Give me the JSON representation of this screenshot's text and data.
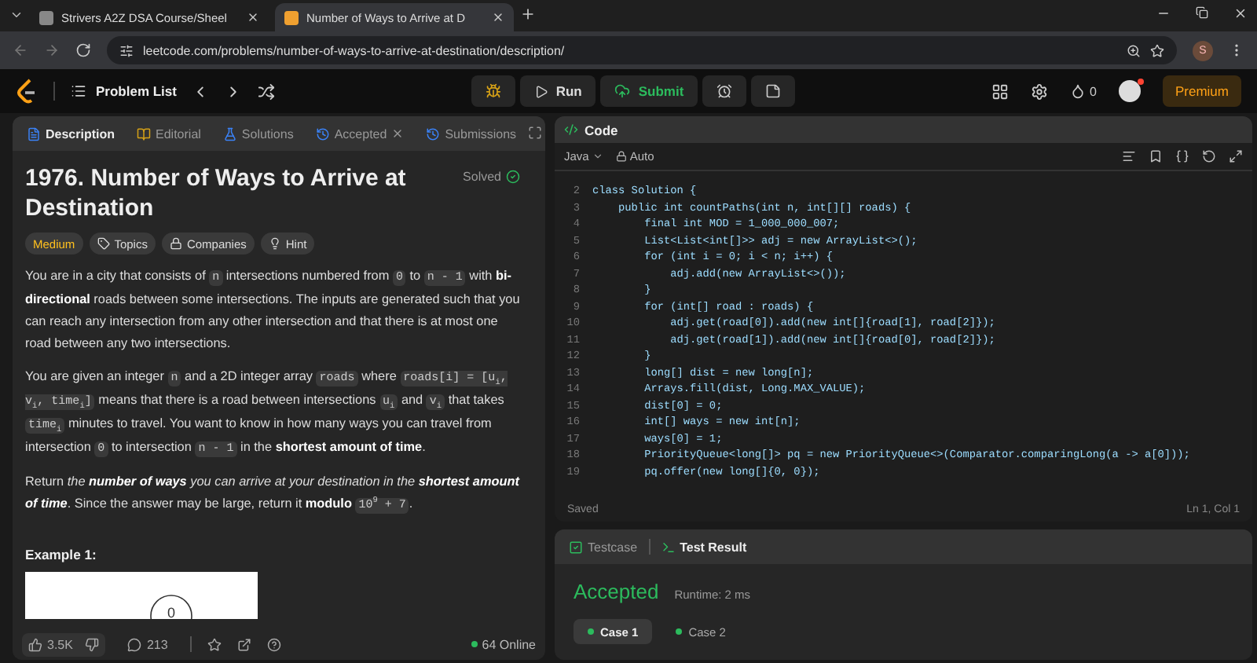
{
  "browser": {
    "tabs": [
      {
        "title": "Strivers A2Z DSA Course/Sheel",
        "selected": false
      },
      {
        "title": "Number of Ways to Arrive at D",
        "selected": true
      }
    ],
    "url": "leetcode.com/problems/number-of-ways-to-arrive-at-destination/description/",
    "profile_initial": "S"
  },
  "header": {
    "problem_list": "Problem List",
    "run": "Run",
    "submit": "Submit",
    "streak": "0",
    "premium": "Premium"
  },
  "description_panel": {
    "tabs": [
      {
        "label": "Description",
        "selected": true,
        "closable": false
      },
      {
        "label": "Editorial",
        "selected": false,
        "closable": false
      },
      {
        "label": "Solutions",
        "selected": false,
        "closable": false
      },
      {
        "label": "Accepted",
        "selected": false,
        "closable": true
      },
      {
        "label": "Submissions",
        "selected": false,
        "closable": false
      }
    ],
    "title": "1976. Number of Ways to Arrive at Destination",
    "status": "Solved",
    "tags": [
      {
        "label": "Medium",
        "kind": "difficulty"
      },
      {
        "label": "Topics",
        "kind": "topics"
      },
      {
        "label": "Companies",
        "kind": "companies"
      },
      {
        "label": "Hint",
        "kind": "hint"
      }
    ],
    "paragraphs": [
      [
        {
          "kind": "text",
          "text": "You are in a city that consists of "
        },
        {
          "kind": "code",
          "text": "n"
        },
        {
          "kind": "text",
          "text": " intersections numbered from "
        },
        {
          "kind": "code",
          "text": "0"
        },
        {
          "kind": "text",
          "text": " to "
        },
        {
          "kind": "code",
          "text": "n - 1"
        },
        {
          "kind": "text",
          "text": " with "
        },
        {
          "kind": "bold",
          "text": "bi-directional"
        },
        {
          "kind": "text",
          "text": " roads between some intersections. The inputs are generated such that you can reach any intersection from any other intersection and that there is at most one road between any two intersections."
        }
      ],
      [
        {
          "kind": "text",
          "text": "You are given an integer "
        },
        {
          "kind": "code",
          "text": "n"
        },
        {
          "kind": "text",
          "text": " and a 2D integer array "
        },
        {
          "kind": "code",
          "text": "roads"
        },
        {
          "kind": "text",
          "text": " where "
        },
        {
          "kind": "code",
          "text": "roads[i] = [u$_{i}$, v$_{i}$, time$_{i}$]"
        },
        {
          "kind": "text",
          "text": " means that there is a road between intersections "
        },
        {
          "kind": "code",
          "text": "u$_{i}$"
        },
        {
          "kind": "text",
          "text": " and "
        },
        {
          "kind": "code",
          "text": "v$_{i}$"
        },
        {
          "kind": "text",
          "text": " that takes "
        },
        {
          "kind": "code",
          "text": "time$_{i}$"
        },
        {
          "kind": "text",
          "text": " minutes to travel. You want to know in how many ways you can travel from intersection "
        },
        {
          "kind": "code",
          "text": "0"
        },
        {
          "kind": "text",
          "text": " to intersection "
        },
        {
          "kind": "code",
          "text": "n - 1"
        },
        {
          "kind": "text",
          "text": " in the "
        },
        {
          "kind": "bold",
          "text": "shortest amount of time"
        },
        {
          "kind": "text",
          "text": "."
        }
      ],
      [
        {
          "kind": "text",
          "text": "Return "
        },
        {
          "kind": "italic",
          "text": "the "
        },
        {
          "kind": "bolditalic",
          "text": "number of ways"
        },
        {
          "kind": "italic",
          "text": " you can arrive at your destination in the "
        },
        {
          "kind": "bolditalic",
          "text": "shortest amount of time"
        },
        {
          "kind": "text",
          "text": ". Since the answer may be large, return it "
        },
        {
          "kind": "bold",
          "text": "modulo "
        },
        {
          "kind": "code",
          "text": "10$^{9}$ + 7"
        },
        {
          "kind": "text",
          "text": "."
        }
      ]
    ],
    "example_heading": "Example 1:",
    "example_node": "0",
    "footer": {
      "likes": "3.5K",
      "comments": "213",
      "online": "64 Online"
    }
  },
  "editor": {
    "title": "Code",
    "language": "Java",
    "mode": "Auto",
    "lines": [
      {
        "number": "2",
        "code": "class Solution {"
      },
      {
        "number": "3",
        "code": "    public int countPaths(int n, int[][] roads) {"
      },
      {
        "number": "4",
        "code": "        final int MOD = 1_000_000_007;"
      },
      {
        "number": "5",
        "code": "        List<List<int[]>> adj = new ArrayList<>();"
      },
      {
        "number": "6",
        "code": "        for (int i = 0; i < n; i++) {"
      },
      {
        "number": "7",
        "code": "            adj.add(new ArrayList<>());"
      },
      {
        "number": "8",
        "code": "        }"
      },
      {
        "number": "9",
        "code": "        for (int[] road : roads) {"
      },
      {
        "number": "10",
        "code": "            adj.get(road[0]).add(new int[]{road[1], road[2]});"
      },
      {
        "number": "11",
        "code": "            adj.get(road[1]).add(new int[]{road[0], road[2]});"
      },
      {
        "number": "12",
        "code": "        }"
      },
      {
        "number": "13",
        "code": "        long[] dist = new long[n];"
      },
      {
        "number": "14",
        "code": "        Arrays.fill(dist, Long.MAX_VALUE);"
      },
      {
        "number": "15",
        "code": "        dist[0] = 0;"
      },
      {
        "number": "16",
        "code": "        int[] ways = new int[n];"
      },
      {
        "number": "17",
        "code": "        ways[0] = 1;"
      },
      {
        "number": "18",
        "code": "        PriorityQueue<long[]> pq = new PriorityQueue<>(Comparator.comparingLong(a -> a[0]));"
      },
      {
        "number": "19",
        "code": "        pq.offer(new long[]{0, 0});"
      }
    ],
    "status": "Saved",
    "cursor": "Ln 1, Col 1"
  },
  "result_panel": {
    "tabs": [
      {
        "label": "Testcase",
        "selected": false
      },
      {
        "label": "Test Result",
        "selected": true
      }
    ],
    "verdict": "Accepted",
    "runtime": "Runtime: 2 ms",
    "cases": [
      {
        "label": "Case 1",
        "selected": true
      },
      {
        "label": "Case 2",
        "selected": false
      }
    ]
  }
}
